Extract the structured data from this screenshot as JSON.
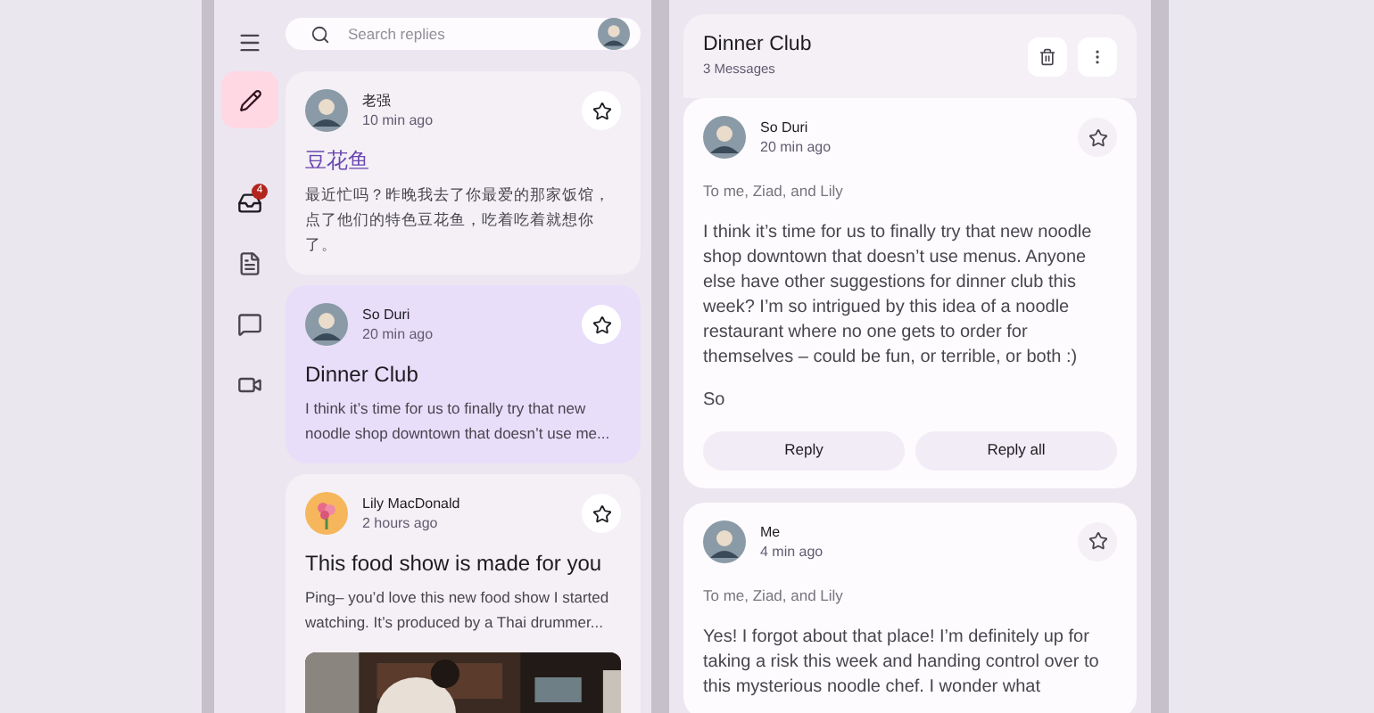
{
  "nav_rail": {
    "badge": "4"
  },
  "search": {
    "placeholder": "Search replies"
  },
  "emails": [
    {
      "sender": "老强",
      "time": "10 min ago",
      "subject": "豆花鱼",
      "preview": "最近忙吗？昨晚我去了你最爱的那家饭馆，点了他们的特色豆花鱼，吃着吃着就想你了。",
      "selected": false,
      "unread": true,
      "avatar": {
        "kind": "person"
      }
    },
    {
      "sender": "So Duri",
      "time": "20 min ago",
      "subject": "Dinner Club",
      "preview": "I think it’s time for us to finally try that new noodle shop downtown that doesn’t use me...",
      "selected": true,
      "unread": false,
      "avatar": {
        "kind": "person"
      }
    },
    {
      "sender": "Lily MacDonald",
      "time": "2 hours ago",
      "subject": "This food show is made for you",
      "preview": "Ping– you’d love this new food show I started watching. It’s produced by a Thai drummer...",
      "selected": false,
      "unread": false,
      "avatar": {
        "kind": "flower"
      }
    }
  ],
  "detail": {
    "title": "Dinner Club",
    "count": "3 Messages",
    "messages": [
      {
        "sender": "So Duri",
        "time": "20 min ago",
        "recipients": "To me, Ziad, and Lily",
        "body": [
          "I think it’s time for us to finally try that new noodle shop downtown that doesn’t use menus. Anyone else have other suggestions for dinner club this week? I’m so intrigued by this idea of a noodle restaurant where no one gets to order for themselves – could be fun, or terrible, or both :)",
          "So"
        ],
        "buttons": [
          "Reply",
          "Reply all"
        ]
      },
      {
        "sender": "Me",
        "time": "4 min ago",
        "recipients": "To me, Ziad, and Lily",
        "body": [
          "Yes! I forgot about that place! I’m definitely up for taking a risk this week and handing control over to this mysterious noodle chef. I wonder what"
        ]
      }
    ]
  }
}
